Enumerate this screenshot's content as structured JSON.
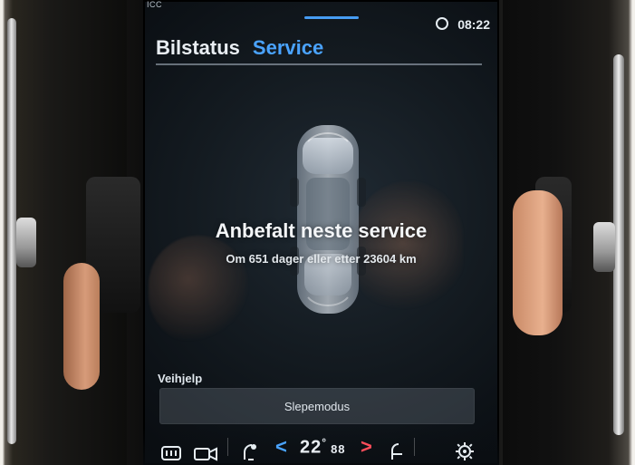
{
  "status_bar": {
    "left_text": "ICC",
    "time": "08:22"
  },
  "tabs": [
    {
      "label": "Bilstatus",
      "active": false
    },
    {
      "label": "Service",
      "active": true
    }
  ],
  "service": {
    "title": "Anbefalt neste service",
    "subtitle": "Om 651 dager eller etter 23604 km"
  },
  "roadside": {
    "section_label": "Veihjelp",
    "button_label": "Slepemodus"
  },
  "climate_bar": {
    "temperature": "22",
    "temperature_unit": "°",
    "fan_level": "88"
  },
  "colors": {
    "accent": "#4aa3ff",
    "warm": "#ff4d5a"
  }
}
